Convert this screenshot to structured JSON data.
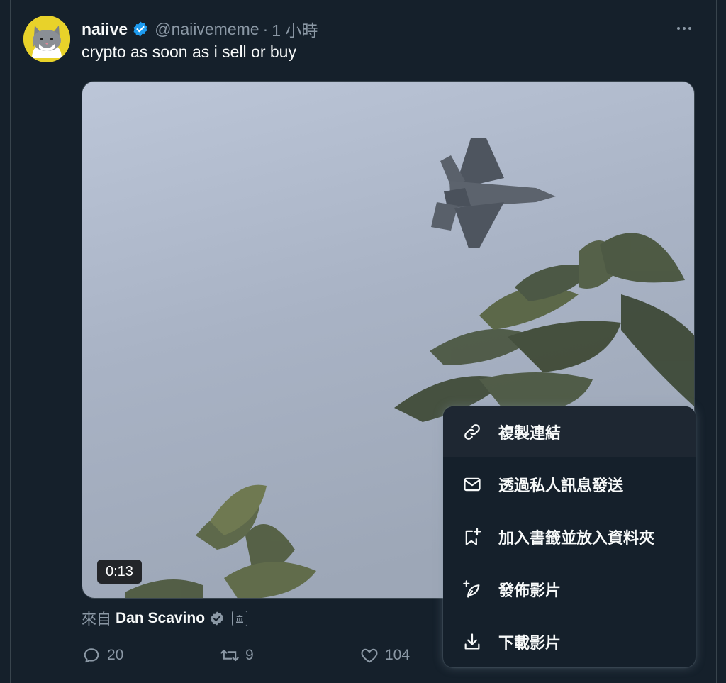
{
  "tweet": {
    "author_name": "naiive",
    "handle": "@naiivememe",
    "separator": "·",
    "time": "1 小時",
    "text": "crypto as soon as i sell or buy",
    "avatar_icon": "cat-avatar-icon",
    "verified_color": "#1d9bf0"
  },
  "media": {
    "duration": "0:13"
  },
  "source": {
    "prefix": "來自",
    "name": "Dan Scavino"
  },
  "actions": {
    "replies": "20",
    "retweets": "9",
    "likes": "104"
  },
  "share_menu": {
    "items": [
      {
        "label": "複製連結",
        "icon": "link-icon"
      },
      {
        "label": "透過私人訊息發送",
        "icon": "envelope-icon"
      },
      {
        "label": "加入書籤並放入資料夾",
        "icon": "bookmark-folder-icon"
      },
      {
        "label": "發佈影片",
        "icon": "feather-icon"
      },
      {
        "label": "下載影片",
        "icon": "download-icon"
      }
    ]
  },
  "colors": {
    "background": "#15202b",
    "text": "#f7f9f9",
    "muted": "#8b98a5",
    "accent": "#1d9bf0"
  }
}
